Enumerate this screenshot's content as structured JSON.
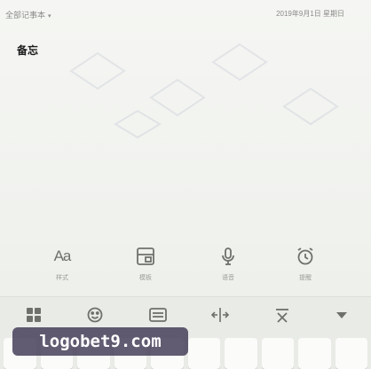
{
  "status_bar": {
    "notebook": "全部记事本",
    "caret": "▾",
    "date": "2019年9月1日 星期日"
  },
  "note": {
    "title": "备忘"
  },
  "toolbar": {
    "items": [
      {
        "icon": "text-format-icon",
        "glyph": "Aa",
        "label": "样式"
      },
      {
        "icon": "template-icon",
        "label": "模板"
      },
      {
        "icon": "microphone-icon",
        "label": "语音"
      },
      {
        "icon": "alarm-clock-icon",
        "label": "提醒"
      }
    ]
  },
  "keyboard_toolbar": {
    "items": [
      {
        "icon": "grid-icon"
      },
      {
        "icon": "emoji-icon"
      },
      {
        "icon": "keyboard-icon"
      },
      {
        "icon": "cursor-move-icon"
      },
      {
        "icon": "cut-icon"
      },
      {
        "icon": "collapse-keyboard-icon"
      }
    ]
  },
  "watermark": {
    "text": "logobet9.com"
  },
  "colors": {
    "background": "#f3f4f1",
    "icon": "#6f716d",
    "keyboard_background": "#e9ebe7",
    "key": "#fbfbfa",
    "watermark_background": "#403854"
  }
}
